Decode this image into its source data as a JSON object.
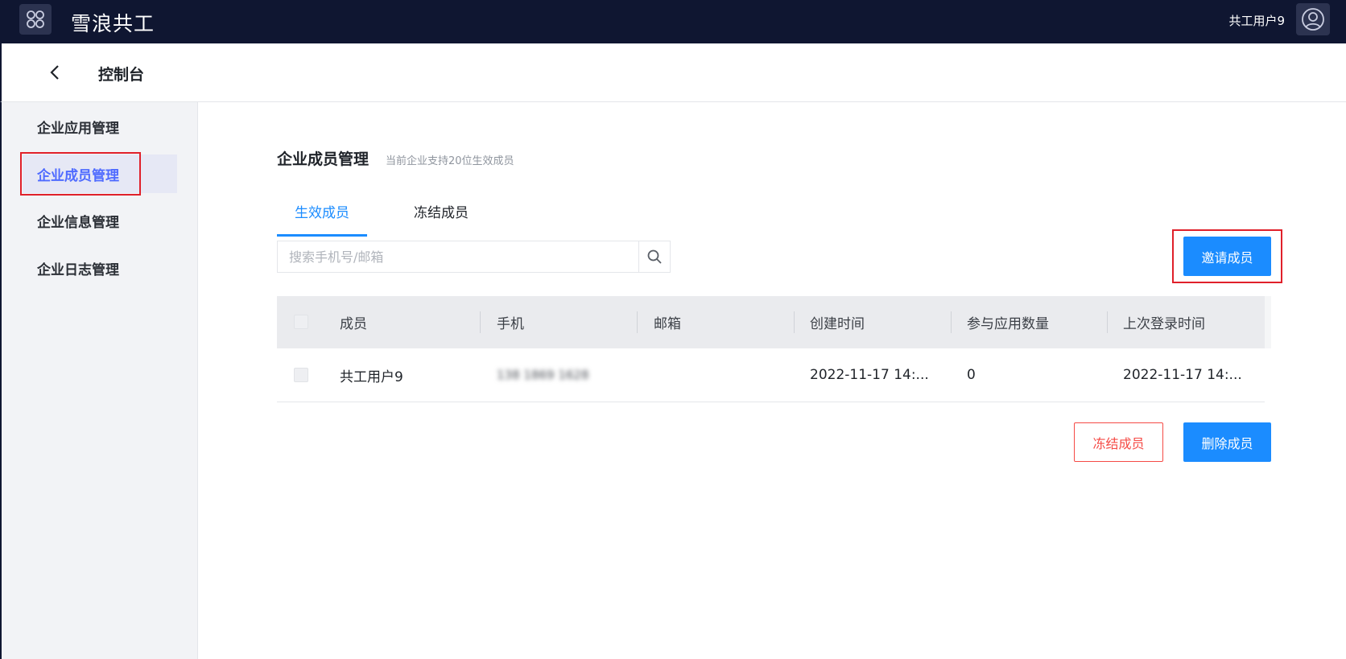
{
  "topbar": {
    "app_icon": "grid-apps-icon",
    "brand": "雪浪共工",
    "user_name": "共工用户9",
    "avatar_icon": "user-avatar-icon"
  },
  "subheader": {
    "back_icon": "chevron-left-icon",
    "title": "控制台"
  },
  "sidebar": {
    "items": [
      {
        "label": "企业应用管理",
        "active": false
      },
      {
        "label": "企业成员管理",
        "active": true
      },
      {
        "label": "企业信息管理",
        "active": false
      },
      {
        "label": "企业日志管理",
        "active": false
      }
    ]
  },
  "main": {
    "title": "企业成员管理",
    "subtitle": "当前企业支持20位生效成员",
    "tabs": [
      {
        "label": "生效成员",
        "active": true
      },
      {
        "label": "冻结成员",
        "active": false
      }
    ],
    "search": {
      "placeholder": "搜索手机号/邮箱",
      "value": "",
      "icon": "search-icon"
    },
    "invite_button": "邀请成员",
    "table": {
      "columns": [
        "成员",
        "手机",
        "邮箱",
        "创建时间",
        "参与应用数量",
        "上次登录时间"
      ],
      "rows": [
        {
          "member": "共工用户9",
          "phone": "138 1869 1628",
          "email": "",
          "created": "2022-11-17 14:...",
          "app_count": "0",
          "last_login": "2022-11-17 14:..."
        }
      ]
    },
    "freeze_button": "冻结成员",
    "delete_button": "删除成员"
  },
  "colors": {
    "topbar_bg": "#0f1631",
    "primary": "#1b8cff",
    "danger": "#f54a45",
    "sidebar_active_text": "#4f6bff",
    "highlight_box": "#e0202a"
  }
}
